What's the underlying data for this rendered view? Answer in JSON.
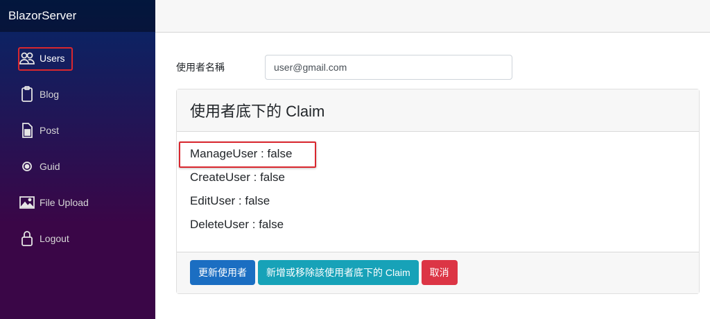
{
  "app": {
    "brand": "BlazorServer"
  },
  "sidebar": {
    "items": [
      {
        "label": "Users",
        "icon": "users-icon",
        "active": true
      },
      {
        "label": "Blog",
        "icon": "clipboard-icon"
      },
      {
        "label": "Post",
        "icon": "document-icon"
      },
      {
        "label": "Guid",
        "icon": "target-icon"
      },
      {
        "label": "File Upload",
        "icon": "image-icon"
      },
      {
        "label": "Logout",
        "icon": "lock-icon"
      }
    ]
  },
  "form": {
    "username_label": "使用者名稱",
    "username_value": "user@gmail.com"
  },
  "card": {
    "title": "使用者底下的 Claim",
    "claims": [
      "ManageUser : false",
      "CreateUser : false",
      "EditUser : false",
      "DeleteUser : false"
    ],
    "buttons": {
      "update": "更新使用者",
      "manage_claims": "新增或移除該使用者底下的 Claim",
      "cancel": "取消"
    }
  },
  "colors": {
    "highlight": "#d9272e",
    "primary": "#1b6ec2",
    "info": "#17a2b8",
    "danger": "#dc3545"
  }
}
